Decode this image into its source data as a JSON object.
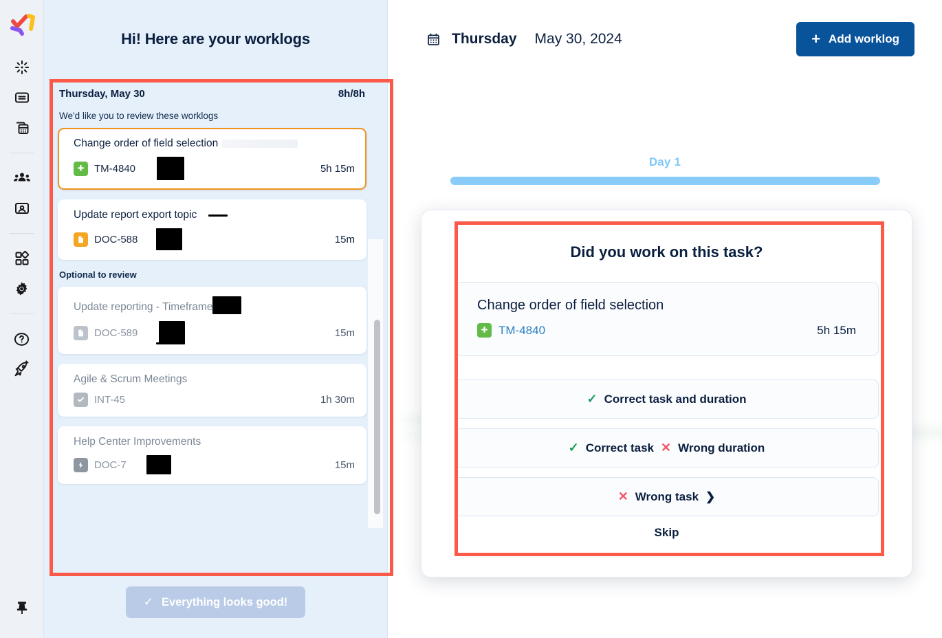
{
  "app": {
    "logo_name": "tempo-logo"
  },
  "rail": {
    "items": [
      {
        "name": "logo",
        "icon": "brand-logo-icon"
      },
      {
        "name": "timesheets",
        "icon": "timer-burst-icon"
      },
      {
        "name": "worklogs",
        "icon": "card-list-icon"
      },
      {
        "name": "reports",
        "icon": "reports-calculator-icon"
      },
      {
        "name": "teams",
        "icon": "people-group-icon"
      },
      {
        "name": "accounts",
        "icon": "id-card-icon"
      },
      {
        "name": "apps",
        "icon": "apps-grid-icon"
      },
      {
        "name": "settings",
        "icon": "gear-icon"
      },
      {
        "name": "help",
        "icon": "question-circle-icon"
      },
      {
        "name": "whats-new",
        "icon": "rocket-icon"
      },
      {
        "name": "pin-sidebar",
        "icon": "pin-icon"
      }
    ]
  },
  "panel": {
    "greeting": "Hi! Here are your worklogs",
    "day_label": "Thursday, May 30",
    "day_total": "8h/8h",
    "review_note": "We'd like you to review these worklogs",
    "optional_note": "Optional to review",
    "review_items": [
      {
        "title": "Change order of field selection",
        "key": "TM-4840",
        "key_icon": "jira-task-plus-icon",
        "key_color": "#62bb46",
        "duration": "5h 15m",
        "selected": true
      },
      {
        "title": "Update report export topic",
        "key": "DOC-588",
        "key_icon": "document-page-icon",
        "key_color": "#f5a623",
        "duration": "15m",
        "selected": false
      }
    ],
    "optional_items": [
      {
        "title": "Update reporting - Timeframe",
        "key": "DOC-589",
        "key_icon": "document-page-icon",
        "key_color": "#bdc3ca",
        "duration": "15m"
      },
      {
        "title": "Agile & Scrum Meetings",
        "key": "INT-45",
        "key_icon": "check-square-icon",
        "key_color": "#b3b9c0",
        "duration": "1h 30m"
      },
      {
        "title": "Help Center Improvements",
        "key": "DOC-7",
        "key_icon": "bolt-square-icon",
        "key_color": "#8e969f",
        "duration": "15m"
      }
    ],
    "confirm_button": "Everything looks good!",
    "confirm_check": "✓"
  },
  "header": {
    "calendar_icon": "calendar-icon",
    "weekday": "Thursday",
    "date": "May 30, 2024",
    "add_button": "Add worklog",
    "add_plus": "+"
  },
  "timeline": {
    "day_label": "Day 1",
    "bar_color": "#89ccf7"
  },
  "modal": {
    "title": "Did you work on this task?",
    "task": {
      "title": "Change order of field selection",
      "key": "TM-4840",
      "key_icon": "jira-task-plus-icon",
      "duration": "5h 15m"
    },
    "options": [
      {
        "label": "Correct task and duration",
        "lead_icon": "check-icon"
      },
      {
        "label_a": "Correct task",
        "label_b": "Wrong duration",
        "lead_icon": "check-icon",
        "mid_icon": "x-icon"
      },
      {
        "label": "Wrong task",
        "lead_icon": "x-icon",
        "trail_icon": "chevron-right-icon"
      }
    ],
    "option_labels": {
      "opt1": "Correct task and duration",
      "opt2a": "Correct task",
      "opt2b": "Wrong duration",
      "opt3": "Wrong task"
    },
    "glyphs": {
      "check": "✓",
      "cross": "✕",
      "chevron": "❯"
    },
    "skip": "Skip"
  },
  "annotations": {
    "accent_color": "#fa5a47",
    "boxes": [
      "worklog-panel",
      "task-review-modal"
    ]
  }
}
